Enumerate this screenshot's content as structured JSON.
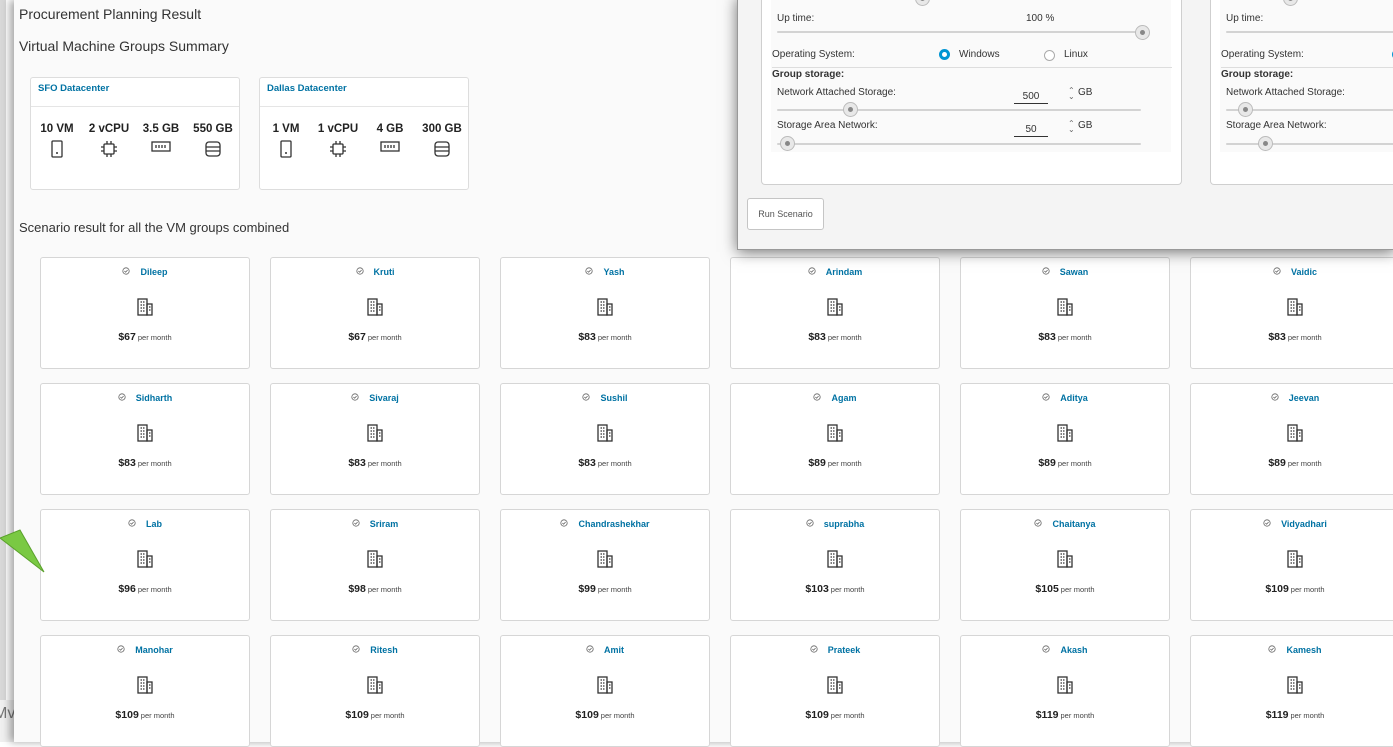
{
  "page": {
    "title": "Procurement Planning Result",
    "summary_title": "Virtual Machine Groups Summary",
    "scenario_title": "Scenario result for all the VM groups combined",
    "partial_left_text": "Mv"
  },
  "datacenters": [
    {
      "name": "SFO Datacenter",
      "vm": "10 VM",
      "cpu": "2 vCPU",
      "mem": "3.5 GB",
      "storage": "550 GB"
    },
    {
      "name": "Dallas Datacenter",
      "vm": "1 VM",
      "cpu": "1 vCPU",
      "mem": "4 GB",
      "storage": "300 GB"
    }
  ],
  "results": [
    {
      "name": "Dileep",
      "price": "$67",
      "unit": "per month"
    },
    {
      "name": "Kruti",
      "price": "$67",
      "unit": "per month"
    },
    {
      "name": "Yash",
      "price": "$83",
      "unit": "per month"
    },
    {
      "name": "Arindam",
      "price": "$83",
      "unit": "per month"
    },
    {
      "name": "Sawan",
      "price": "$83",
      "unit": "per month"
    },
    {
      "name": "Vaidic",
      "price": "$83",
      "unit": "per month"
    },
    {
      "name": "Sidharth",
      "price": "$83",
      "unit": "per month"
    },
    {
      "name": "Sivaraj",
      "price": "$83",
      "unit": "per month"
    },
    {
      "name": "Sushil",
      "price": "$83",
      "unit": "per month"
    },
    {
      "name": "Agam",
      "price": "$89",
      "unit": "per month"
    },
    {
      "name": "Aditya",
      "price": "$89",
      "unit": "per month"
    },
    {
      "name": "Jeevan",
      "price": "$89",
      "unit": "per month"
    },
    {
      "name": "Lab",
      "price": "$96",
      "unit": "per month"
    },
    {
      "name": "Sriram",
      "price": "$98",
      "unit": "per month"
    },
    {
      "name": "Chandrashekhar",
      "price": "$99",
      "unit": "per month"
    },
    {
      "name": "suprabha",
      "price": "$103",
      "unit": "per month"
    },
    {
      "name": "Chaitanya",
      "price": "$105",
      "unit": "per month"
    },
    {
      "name": "Vidyadhari",
      "price": "$109",
      "unit": "per month"
    },
    {
      "name": "Manohar",
      "price": "$109",
      "unit": "per month"
    },
    {
      "name": "Ritesh",
      "price": "$109",
      "unit": "per month"
    },
    {
      "name": "Amit",
      "price": "$109",
      "unit": "per month"
    },
    {
      "name": "Prateek",
      "price": "$109",
      "unit": "per month"
    },
    {
      "name": "Akash",
      "price": "$119",
      "unit": "per month"
    },
    {
      "name": "Kamesh",
      "price": "$119",
      "unit": "per month"
    }
  ],
  "scenario_panel": {
    "uptime_label": "Up time:",
    "uptime_value": "100 %",
    "uptime_fraction": 1.0,
    "os_label": "Operating System:",
    "os_windows": "Windows",
    "os_linux": "Linux",
    "os_selected": "Windows",
    "group_storage_label": "Group storage:",
    "nas_label": "Network Attached Storage:",
    "nas_value": "500",
    "nas_unit": "GB",
    "san_label": "Storage Area Network:",
    "san_value": "50",
    "san_unit": "GB",
    "run_button": "Run Scenario"
  },
  "colors": {
    "link_blue": "#0072a3",
    "radio_blue": "#0095d3",
    "arrow_green": "#7ac943"
  },
  "icons": {
    "vm": "server-icon",
    "cpu": "cpu-chip-icon",
    "memory": "memory-icon",
    "storage": "database-icon",
    "result": "building-icon",
    "check": "check-circle-icon"
  }
}
